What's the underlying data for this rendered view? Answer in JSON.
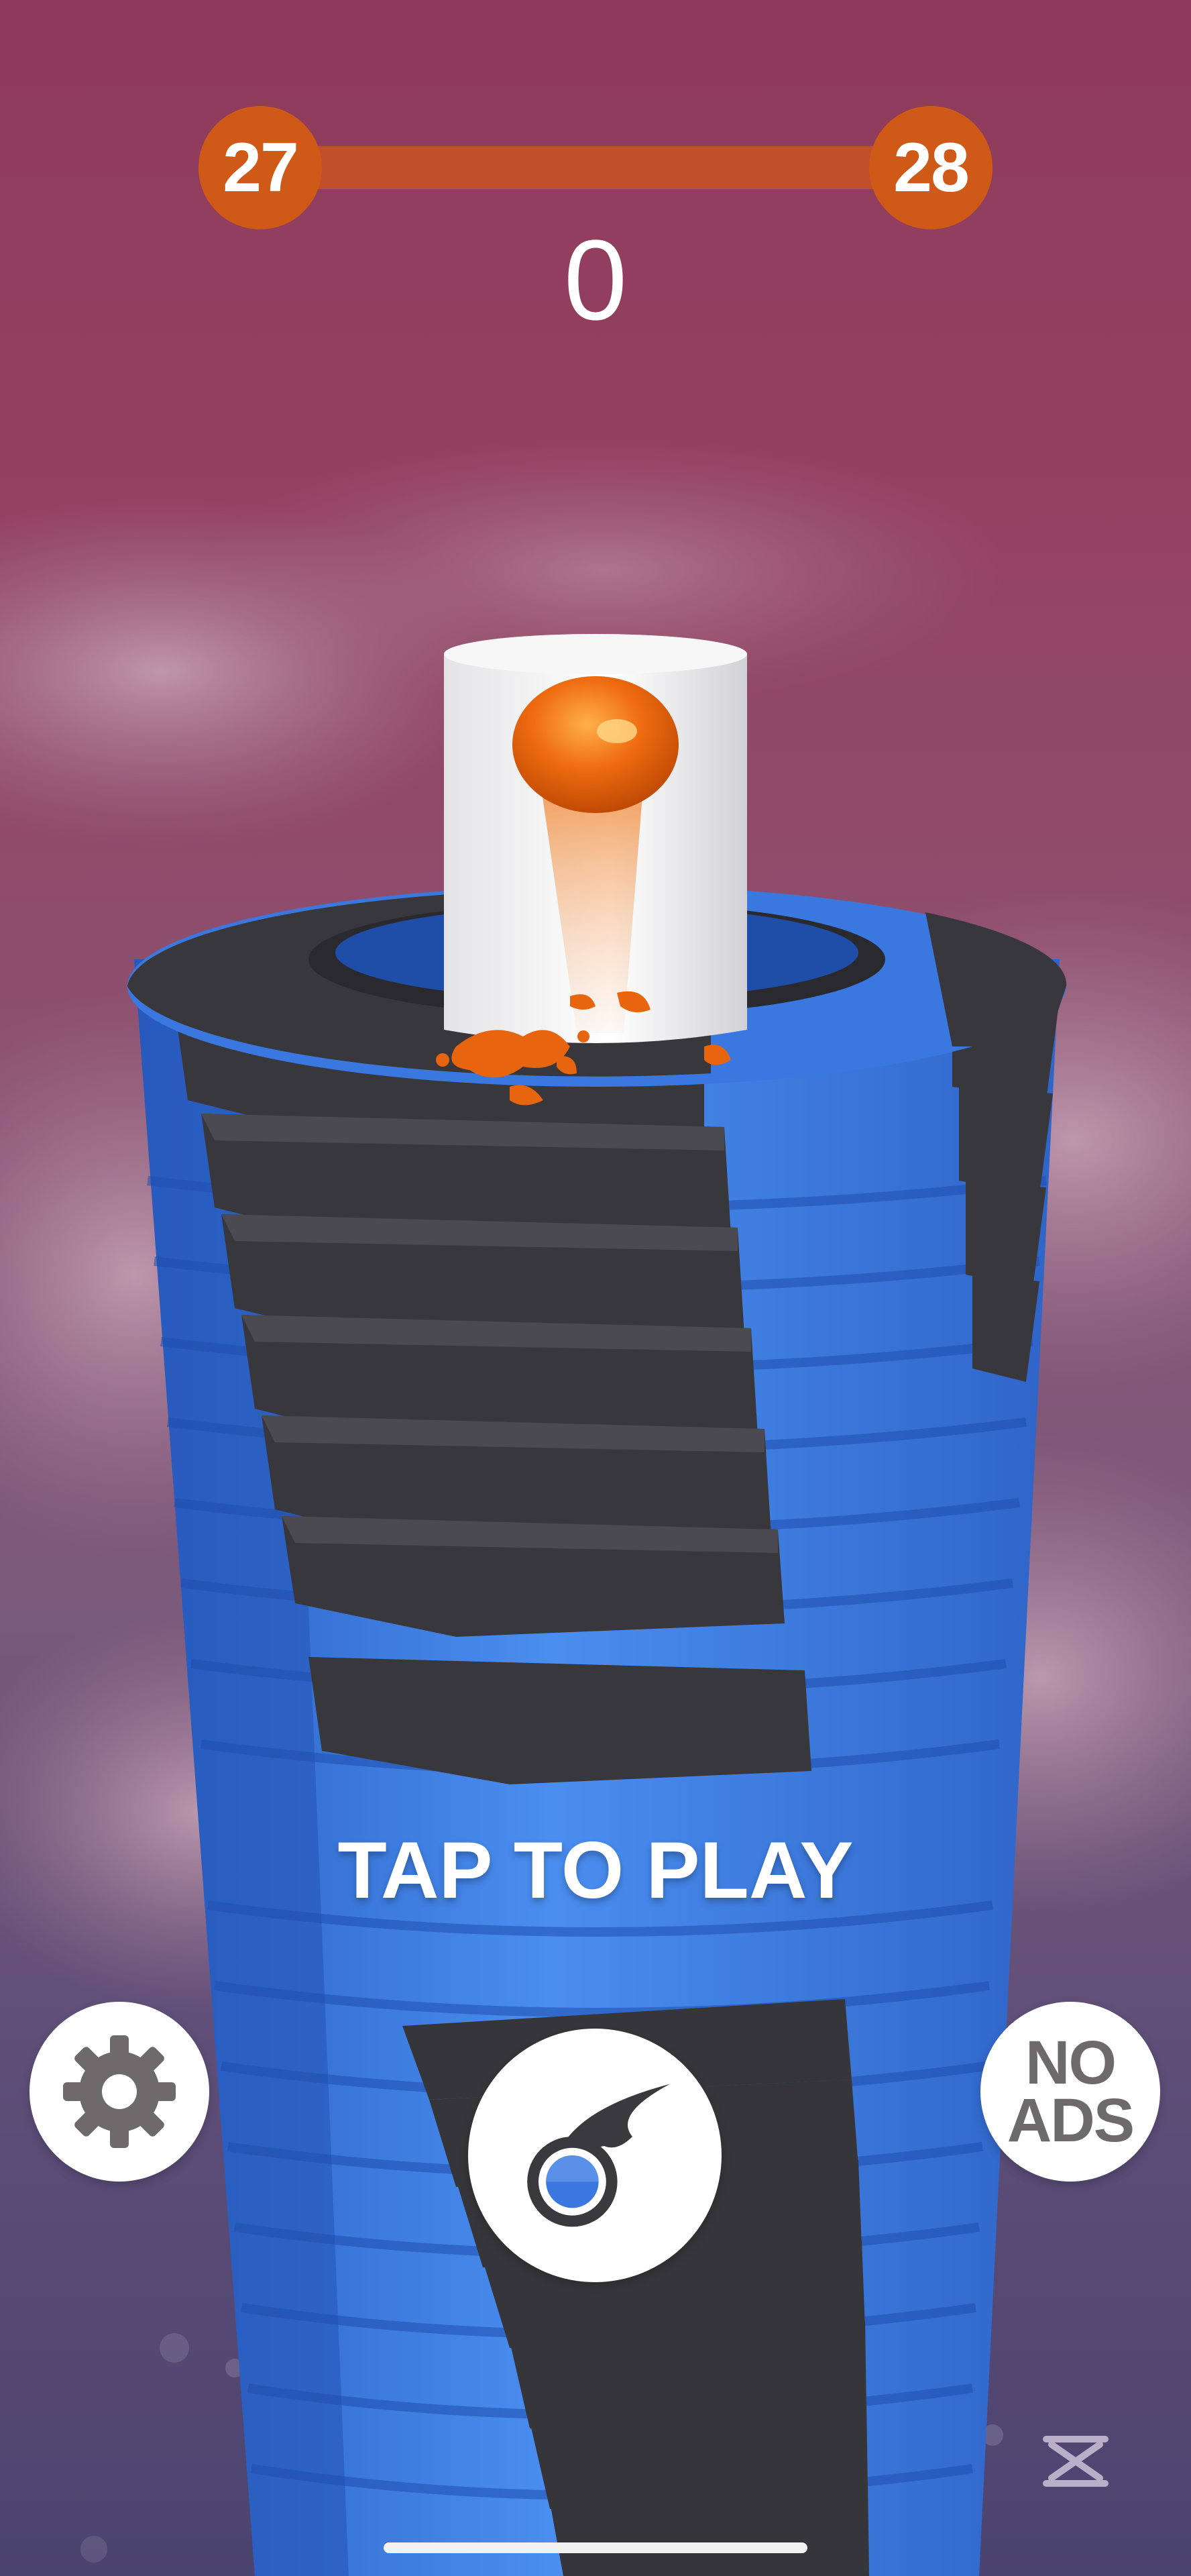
{
  "hud": {
    "current_level": "27",
    "next_level": "28",
    "level_progress": 0,
    "score": "0"
  },
  "prompt": {
    "tap_to_play": "TAP TO PLAY"
  },
  "buttons": {
    "settings_icon": "gear-icon",
    "no_ads_line1": "NO",
    "no_ads_line2": "ADS",
    "ball_skin_icon": "comet-ball-icon"
  },
  "colors": {
    "accent": "#cf5a17",
    "progress_track": "#c0502c",
    "tower_blue": "#3a78e0",
    "tower_black": "#3a3a3e",
    "ball": "#e8650f"
  }
}
